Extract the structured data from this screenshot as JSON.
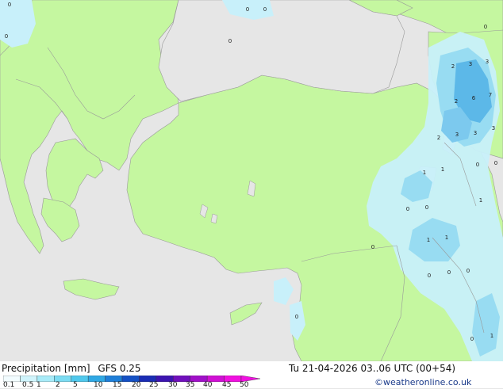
{
  "map": {
    "markers": [
      {
        "label": "0"
      },
      {
        "label": "0"
      },
      {
        "label": "0"
      },
      {
        "label": "0"
      },
      {
        "label": "0"
      },
      {
        "label": "0"
      },
      {
        "label": "2"
      },
      {
        "label": "3"
      },
      {
        "label": "3"
      },
      {
        "label": "2"
      },
      {
        "label": "6"
      },
      {
        "label": "7"
      },
      {
        "label": "3"
      },
      {
        "label": "2"
      },
      {
        "label": "3"
      },
      {
        "label": "3"
      },
      {
        "label": "0"
      },
      {
        "label": "1"
      },
      {
        "label": "1"
      },
      {
        "label": "0"
      },
      {
        "label": "1"
      },
      {
        "label": "0"
      },
      {
        "label": "0"
      },
      {
        "label": "1"
      },
      {
        "label": "1"
      },
      {
        "label": "0"
      },
      {
        "label": "0"
      },
      {
        "label": "0"
      },
      {
        "label": "0"
      },
      {
        "label": "0"
      },
      {
        "label": "0"
      },
      {
        "label": "1"
      }
    ]
  },
  "footer": {
    "left_label": "Precipitation [mm]",
    "model": "GFS 0.25",
    "datetime": "Tu 21-04-2026 03..06 UTC (00+54)",
    "credit": "©weatheronline.co.uk"
  },
  "colorbar": {
    "ticks": [
      "0.1",
      "0.5",
      "1",
      "2",
      "5",
      "10",
      "15",
      "20",
      "25",
      "30",
      "35",
      "40",
      "45",
      "50"
    ],
    "colors": [
      "#f2fcff",
      "#d0f4fc",
      "#a8ebf8",
      "#7cdcf2",
      "#50c8ec",
      "#30a8e4",
      "#1e7ed8",
      "#1450c4",
      "#1a2cb4",
      "#3c14b0",
      "#7010bc",
      "#a010c8",
      "#d010d4",
      "#f010e0"
    ]
  },
  "colors": {
    "land": "#c5f7a0",
    "sea": "#e6e6e6",
    "border": "#999999",
    "rain_light": "#c8f0fa",
    "rain_mid": "#98dcf2",
    "rain_heavy": "#5cb8e8"
  }
}
